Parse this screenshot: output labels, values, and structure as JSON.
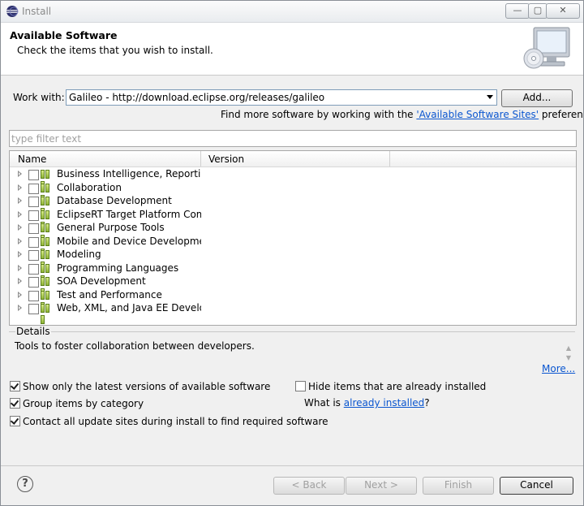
{
  "window": {
    "title": "Install",
    "min_symbol": "—",
    "max_symbol": "▢",
    "close_symbol": "✕"
  },
  "header": {
    "title": "Available Software",
    "description": "Check the items that you wish to install."
  },
  "work_with": {
    "label": "Work with:",
    "value": "Galileo - http://download.eclipse.org/releases/galileo",
    "add_label": "Add...",
    "find_more_prefix": "Find more software by working with the ",
    "find_more_link": "'Available Software Sites'",
    "find_more_suffix": " preferences."
  },
  "filter": {
    "placeholder": "type filter text"
  },
  "tree": {
    "columns": {
      "name": "Name",
      "version": "Version"
    },
    "items": [
      {
        "label": "Business Intelligence, Reporting and Charting"
      },
      {
        "label": "Collaboration"
      },
      {
        "label": "Database Development"
      },
      {
        "label": "EclipseRT Target Platform Components"
      },
      {
        "label": "General Purpose Tools"
      },
      {
        "label": "Mobile and Device Development"
      },
      {
        "label": "Modeling"
      },
      {
        "label": "Programming Languages"
      },
      {
        "label": "SOA Development"
      },
      {
        "label": "Test and Performance"
      },
      {
        "label": "Web, XML, and Java EE Development"
      }
    ]
  },
  "details": {
    "title": "Details",
    "text": "Tools to foster collaboration between developers.",
    "more": "More..."
  },
  "options": {
    "show_latest": {
      "label": "Show only the latest versions of available software",
      "checked": true
    },
    "group_by_category": {
      "label": "Group items by category",
      "checked": true
    },
    "contact_all": {
      "label": "Contact all update sites during install to find required software",
      "checked": true
    },
    "hide_installed": {
      "label": "Hide items that are already installed",
      "checked": false
    },
    "what_is_prefix": "What is ",
    "what_is_link": "already installed",
    "what_is_suffix": "?"
  },
  "buttons": {
    "help": "?",
    "back": "< Back",
    "next": "Next >",
    "finish": "Finish",
    "cancel": "Cancel"
  }
}
